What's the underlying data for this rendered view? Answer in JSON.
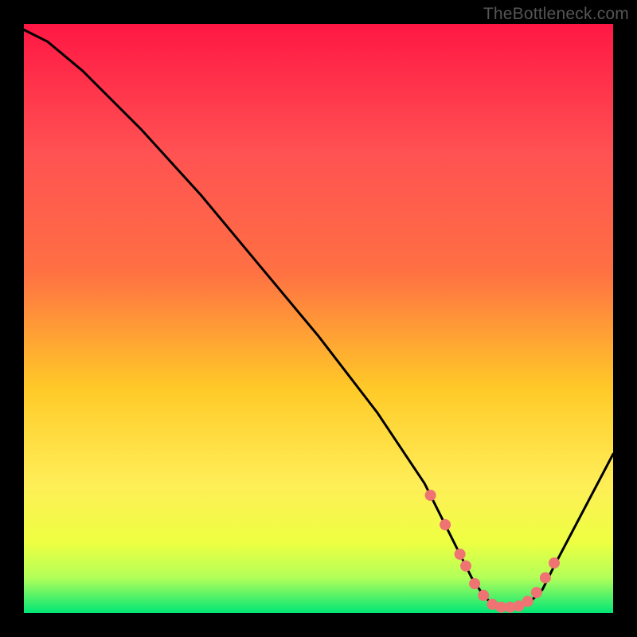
{
  "watermark": "TheBottleneck.com",
  "chart_data": {
    "type": "line",
    "title": "",
    "xlabel": "",
    "ylabel": "",
    "xlim": [
      0,
      100
    ],
    "ylim": [
      0,
      100
    ],
    "series": [
      {
        "name": "bottleneck-curve",
        "x": [
          0,
          4,
          10,
          20,
          30,
          40,
          50,
          60,
          68,
          72,
          74,
          76,
          78,
          80,
          82,
          84,
          86,
          88,
          90,
          100
        ],
        "values": [
          99,
          97,
          92,
          82,
          71,
          59,
          47,
          34,
          22,
          14,
          10,
          6,
          3,
          1,
          1,
          1,
          2,
          4,
          8,
          27
        ]
      }
    ],
    "markers": {
      "name": "dotted-salmon-points",
      "x": [
        69.0,
        71.5,
        74.0,
        75.0,
        76.5,
        78.0,
        79.5,
        81.0,
        82.5,
        84.0,
        85.5,
        87.0,
        88.5,
        90.0
      ],
      "values": [
        20.0,
        15.0,
        10.0,
        8.0,
        5.0,
        3.0,
        1.5,
        1.0,
        1.0,
        1.2,
        2.0,
        3.5,
        6.0,
        8.5
      ]
    },
    "background_gradient": {
      "top": "#ff1744",
      "mid1": "#ff7043",
      "mid2": "#ffca28",
      "mid3": "#ffee58",
      "low": "#eeff41",
      "bottom": "#00e676"
    }
  }
}
